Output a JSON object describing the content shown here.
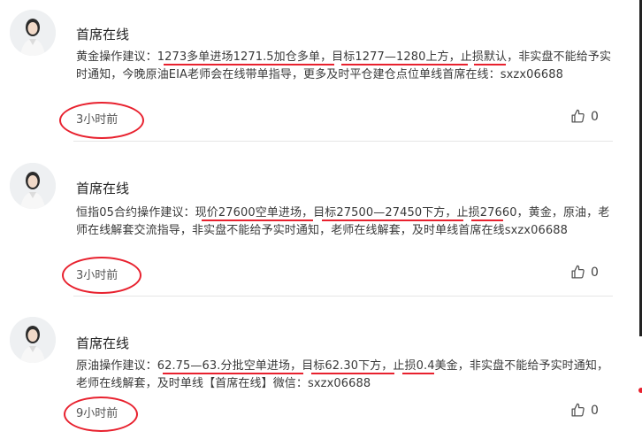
{
  "comments": [
    {
      "username": "首席在线",
      "content": "黄金操作建议：1273多单进场1271.5加仓多单，目标1277—1280上方，止损默认，非实盘不能给予实时通知，今晚原油EIA老师会在线带单指导，更多及时平仓建仓点位单线首席在线：sxzx06688",
      "time": "3小时前",
      "likes": "0"
    },
    {
      "username": "首席在线",
      "content": "恒指05合约操作建议：现价27600空单进场，目标27500—27450下方，止损27660，黄金，原油，老师在线解套交流指导，非实盘不能给予实时通知，老师在线解套，及时单线首席在线sxzx06688",
      "time": "3小时前",
      "likes": "0"
    },
    {
      "username": "首席在线",
      "content": "原油操作建议：62.75—63.分批空单进场，目标62.30下方，止损0.4美金，非实盘不能给予实时通知，老师在线解套，及时单线【首席在线】微信：sxzx06688",
      "time": "9小时前",
      "likes": "0"
    }
  ],
  "colors": {
    "annotation_red": "#e8212e",
    "divider": "#e6e6e6",
    "text": "#333333"
  },
  "icons": {
    "avatar": "avatar-photo",
    "like": "thumbs-up-icon"
  }
}
